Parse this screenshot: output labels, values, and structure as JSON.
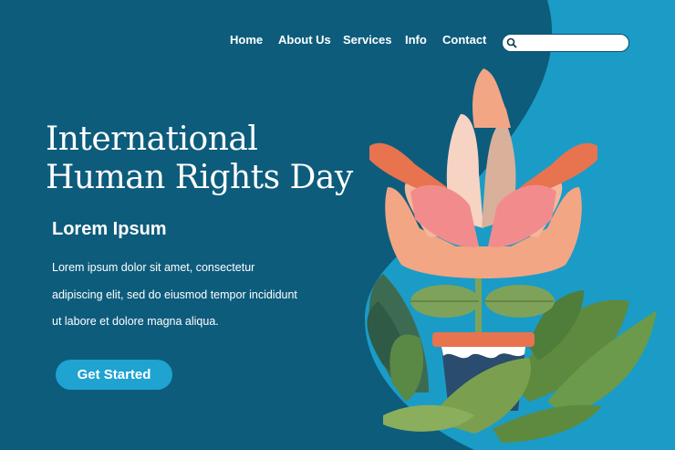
{
  "nav": {
    "items": [
      {
        "label": "Home"
      },
      {
        "label": "About Us"
      },
      {
        "label": "Services"
      },
      {
        "label": "Info"
      },
      {
        "label": "Contact"
      }
    ]
  },
  "search": {
    "placeholder": ""
  },
  "hero": {
    "title_line1": "International",
    "title_line2": "Human Rights Day",
    "subtitle": "Lorem Ipsum",
    "body_line1": "Lorem ipsum dolor sit amet, consectetur",
    "body_line2": "adipiscing elit, sed do eiusmod tempor incididunt",
    "body_line3": "ut labore et dolore magna aliqua.",
    "cta_label": "Get Started"
  },
  "colors": {
    "background": "#0d5c7c",
    "accent_blob": "#1a9cc7",
    "button": "#1fa3d1",
    "leaf_green": "#6b9a4a",
    "pot_blue": "#2a4c6e",
    "pot_rim": "#e8734f"
  },
  "illustration": {
    "icon": "hands-flower-pot-illustration"
  }
}
